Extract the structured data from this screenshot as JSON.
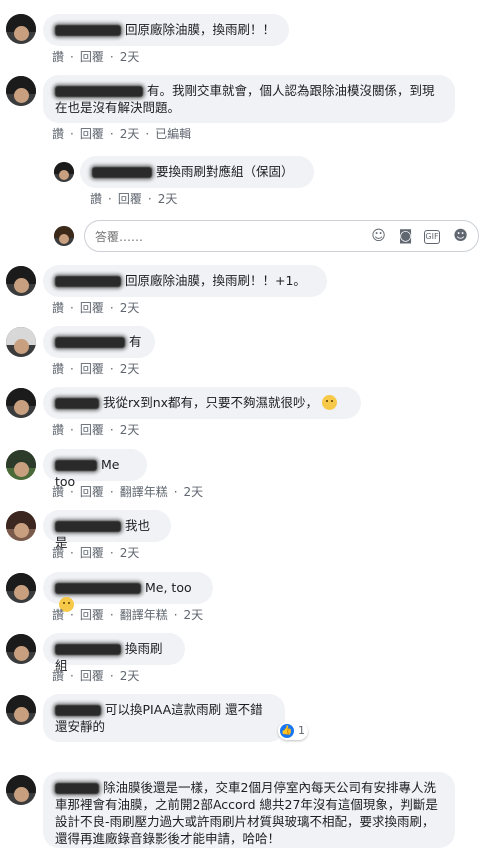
{
  "actions": {
    "like": "讚",
    "reply": "回覆",
    "translate": "翻譯年糕",
    "edited": "已編輯"
  },
  "reply_box": {
    "placeholder": "答覆……"
  },
  "reply_box_icons": [
    "smiley-icon",
    "camera-icon",
    "gif-icon",
    "sticker-icon"
  ],
  "comments": [
    {
      "text": "回原廠除油膜，換雨刷！！",
      "time": "2天"
    },
    {
      "text": "有。我剛交車就會，個人認為跟除油模沒關係，到現在也是沒有解決問題。",
      "time": "2天"
    },
    {
      "text": "要換雨刷對應組（保固）",
      "time": "2天"
    },
    {
      "text": "回原廠除油膜，換雨刷！！+1。",
      "time": "2天"
    },
    {
      "text": "有",
      "time": "2天"
    },
    {
      "text": "我從rx到nx都有，只要不夠濕就很吵，",
      "time": "2天"
    },
    {
      "text": "Me too",
      "time": "2天"
    },
    {
      "text": "我也是",
      "time": "2天"
    },
    {
      "text": "Me, too",
      "time": "2天"
    },
    {
      "text": "換雨刷組",
      "time": "2天"
    },
    {
      "text": "可以換PIAA這款雨刷 還不錯 還安靜的",
      "time": "2天",
      "likes": "1"
    },
    {
      "text": "除油膜後還是一樣，交車2個月停室內每天公司有安排專人洗車那裡會有油膜，之前開2部Accord 總共27年沒有這個現象，判斷是設計不良-雨刷壓力過大或許雨刷片材質與玻璃不相配，要求換雨刷，還得再進廠錄音錄影後才能申請，哈哈！"
    }
  ]
}
